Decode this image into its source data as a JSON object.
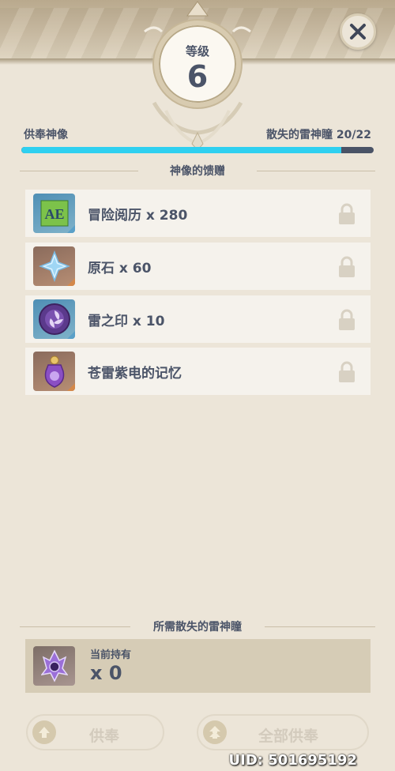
{
  "header": {
    "level_label": "等级",
    "level_value": "6"
  },
  "progress": {
    "left_label": "供奉神像",
    "right_label": "散失的雷神瞳",
    "current": "20",
    "separator": "/",
    "total": "22",
    "fraction": 0.909
  },
  "rewards": {
    "title": "神像的馈赠",
    "items": [
      {
        "name": "冒险阅历 x 280",
        "icon": "adventure-exp-icon",
        "rarity_color": "#5aa0c8"
      },
      {
        "name": "原石 x 60",
        "icon": "primogem-icon",
        "rarity_color": "#d4884a"
      },
      {
        "name": "雷之印 x 10",
        "icon": "electro-sigil-icon",
        "rarity_color": "#5aa0c8"
      },
      {
        "name": "苍雷紫电的记忆",
        "icon": "electro-memory-icon",
        "rarity_color": "#d4884a"
      }
    ]
  },
  "required": {
    "title": "所需散失的雷神瞳",
    "held_label": "当前持有",
    "held_count": "x 0"
  },
  "buttons": {
    "offer": "供奉",
    "offer_all": "全部供奉"
  },
  "uid": "UID: 501695192",
  "colors": {
    "accent": "#2fd0f0",
    "text": "#4b5468",
    "background": "#ece5d8"
  }
}
